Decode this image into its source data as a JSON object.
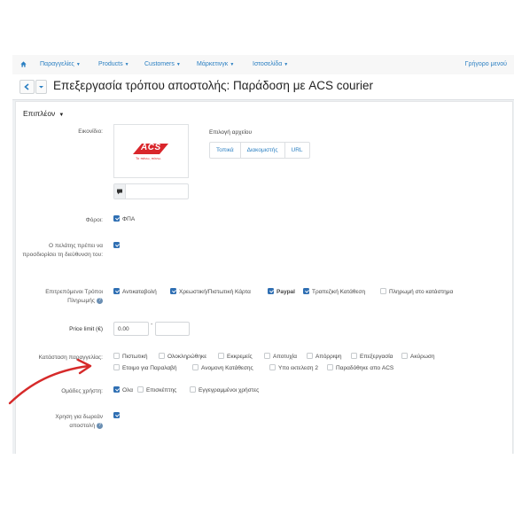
{
  "nav": {
    "items": [
      {
        "label": "Παραγγελίες"
      },
      {
        "label": "Products"
      },
      {
        "label": "Customers"
      },
      {
        "label": "Μάρκετινγκ"
      },
      {
        "label": "Ιστοσελίδα"
      }
    ],
    "quick_menu": "Γρήγορο μενού"
  },
  "title": "Επεξεργασία τρόπου αποστολής: Παράδοση με ACS courier",
  "panel": {
    "header": "Επιπλέον",
    "image": {
      "label": "Εικονίδιο:",
      "logo_text": "ACS",
      "logo_tagline": "Το πάνω, πάνω.",
      "picker_label": "Επιλογή αρχείου",
      "tabs": [
        "Τοπικά",
        "Διακομιστής",
        "URL"
      ]
    },
    "taxes": {
      "label": "Φόροι:",
      "option": "ΦΠΑ",
      "checked": true
    },
    "address": {
      "label": "Ο πελάτης πρέπει να προσδιορίσει τη διεύθυνση του:",
      "checked": true
    },
    "payments": {
      "label": "Επιτρεπόμενοι Τρόποι Πληρωμής",
      "options": [
        {
          "label": "Αντικαταβολή",
          "checked": true
        },
        {
          "label": "Χρεωστική/Πιστωτική Κάρτα",
          "checked": true
        },
        {
          "label": "Paypal",
          "checked": true
        },
        {
          "label": "Τραπεζική Κατάθεση",
          "checked": true
        },
        {
          "label": "Πληρωμή στο κατάστημα",
          "checked": false
        }
      ]
    },
    "price_limit": {
      "label": "Price limit (€)",
      "min_value": "0.00",
      "max_value": ""
    },
    "order_status": {
      "label": "Κατάσταση παραγγελίας:",
      "row1": [
        "Πιστωτική",
        "Ολοκληρώθηκε",
        "Εκκρεμείς",
        "Αποτυχία",
        "Απόρριψη",
        "Επεξεργασία",
        "Ακύρωση"
      ],
      "row2": [
        "Ετοιμο για Παραλαβή",
        "Ανομονη Κατάθεσης",
        "Υπο εκτελεση 2",
        "Παραδόθηκε απο ACS"
      ]
    },
    "user_groups": {
      "label": "Ομάδες χρήστη:",
      "options": [
        {
          "label": "Ολα",
          "checked": true
        },
        {
          "label": "Επισκέπτης",
          "checked": false
        },
        {
          "label": "Εγγεγραμμένοι χρήστες",
          "checked": false
        }
      ]
    },
    "free_shipping": {
      "label": "Χρηση για δωρεάν αποστολή",
      "checked": true
    }
  },
  "colors": {
    "accent": "#2f6fb3",
    "link": "#2a7fc2",
    "arrow": "#d62a2a"
  }
}
